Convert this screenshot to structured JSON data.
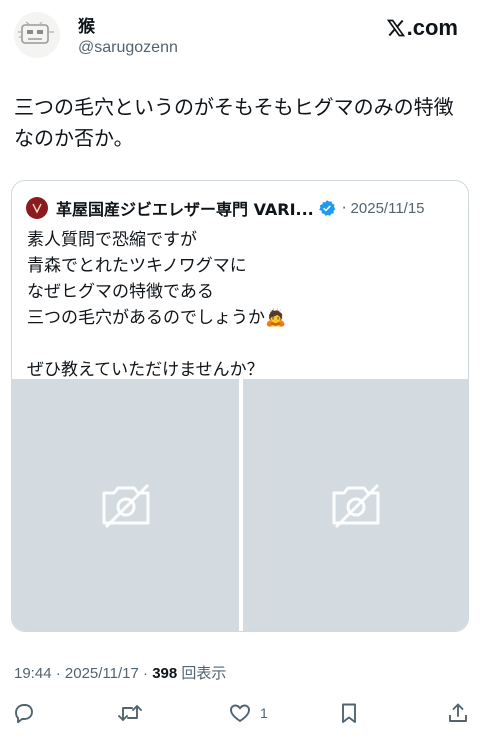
{
  "author": {
    "display_name": "猴",
    "handle": "@sarugozenn",
    "avatar_icon": "sketch-face-avatar"
  },
  "brand": {
    "text": ".com",
    "icon": "x-logo-icon"
  },
  "tweet": {
    "text": "三つの毛穴というのがそもそもヒグマのみの特徴なのか否か。"
  },
  "quote": {
    "author_name": "革屋国産ジビエレザー専門 VARI...",
    "verified": true,
    "separator": "·",
    "date": "2025/11/15",
    "text": "素人質問で恐縮ですが\n青森でとれたツキノワグマに\nなぜヒグマの特徴である\n三つの毛穴があるのでしょうか🙇\n\nぜひ教えていただけませんか？",
    "media": [
      {
        "icon": "image-unavailable-icon"
      },
      {
        "icon": "image-unavailable-icon"
      }
    ]
  },
  "meta": {
    "time": "19:44",
    "sep1": "·",
    "date": "2025/11/17",
    "sep2": "·",
    "views": "398",
    "views_label": "回表示"
  },
  "actions": {
    "reply": {
      "icon": "reply-icon"
    },
    "repost": {
      "icon": "repost-icon"
    },
    "like": {
      "icon": "heart-icon",
      "count": "1"
    },
    "bookmark": {
      "icon": "bookmark-icon"
    },
    "share": {
      "icon": "share-icon"
    }
  },
  "colors": {
    "text": "#0f1419",
    "secondary": "#536471",
    "verified": "#1d9bf0",
    "media_placeholder": "#d3dbe1",
    "quote_avatar": "#8b1b1f"
  }
}
